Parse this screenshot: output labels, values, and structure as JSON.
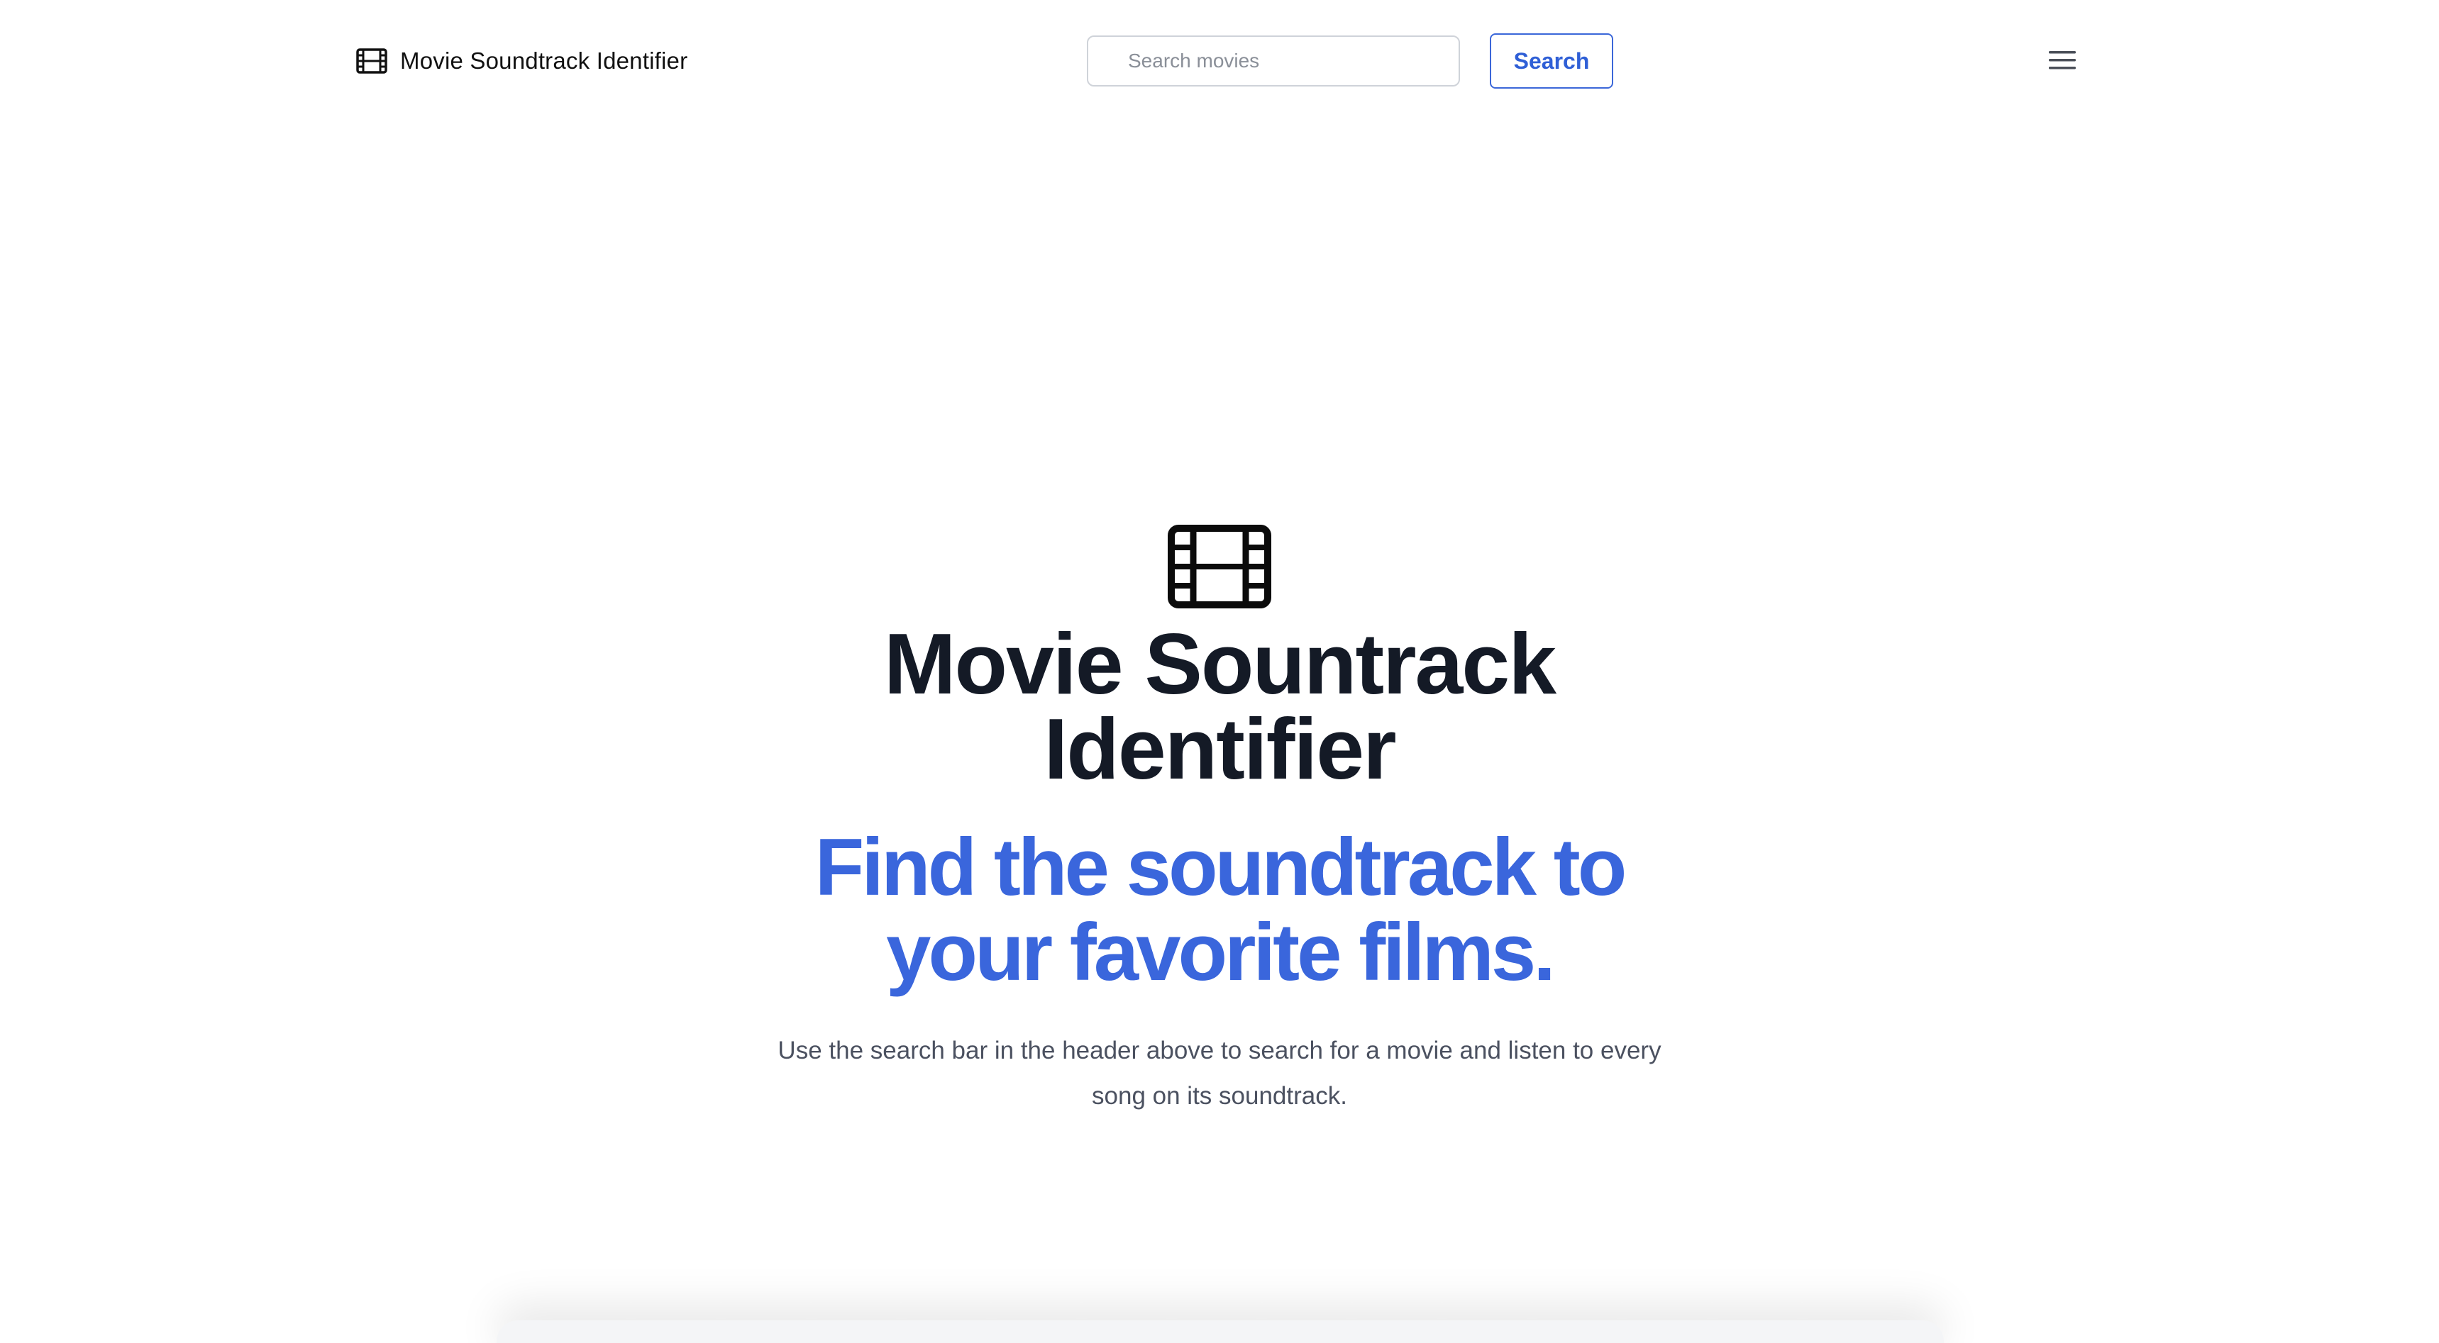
{
  "header": {
    "brand_icon": "film-icon",
    "brand_name": "Movie Soundtrack Identifier",
    "search": {
      "placeholder": "Search movies",
      "value": ""
    },
    "search_button_label": "Search",
    "menu_icon": "hamburger-menu-icon"
  },
  "hero": {
    "icon": "film-icon",
    "title": "Movie Sountrack Identifier",
    "subtitle": "Find the soundtrack to your favorite films.",
    "description": "Use the search bar in the header above to search for a movie and listen to every song on its soundtrack."
  },
  "colors": {
    "accent": "#3a66dc",
    "title_text": "#141a26",
    "body_text": "#4b5160",
    "input_border": "#cfd3d9"
  }
}
